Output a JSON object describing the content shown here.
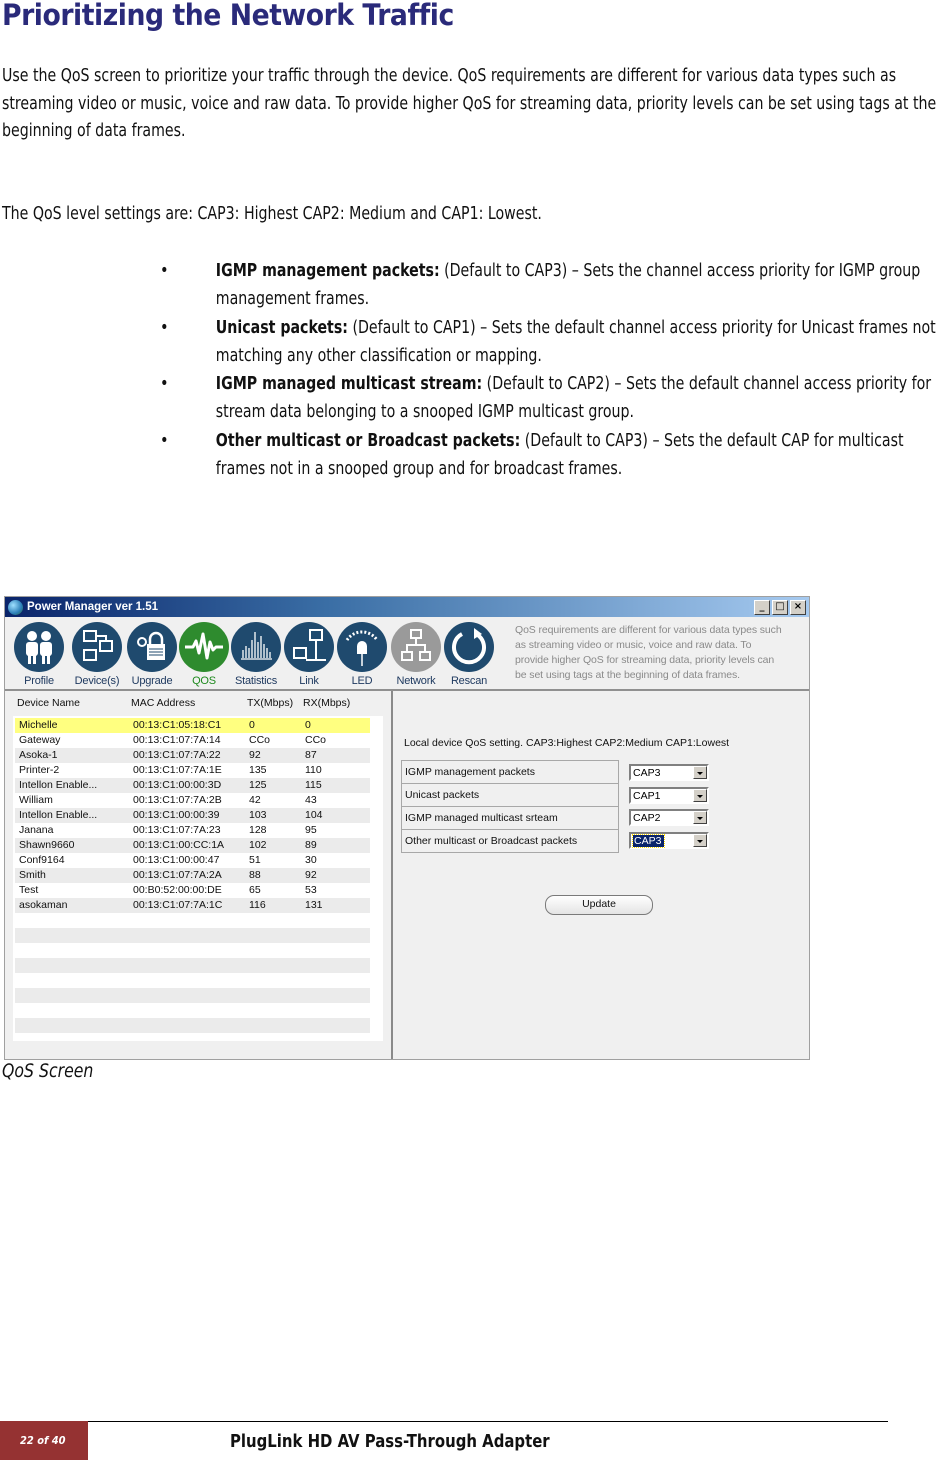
{
  "document": {
    "title": "Prioritizing the Network Traffic",
    "intro": "Use the QoS screen to prioritize your traffic through the device. QoS requirements are different for various data types such as streaming video or music, voice and raw data. To provide higher QoS for streaming data, priority levels can be set using tags at the beginning of data frames.",
    "levels": "The QoS level settings are: CAP3: Highest CAP2: Medium and CAP1: Lowest.",
    "bullets": [
      {
        "term": "IGMP management packets:",
        "text": " (Default to CAP3) – Sets the channel access priority for IGMP group management frames."
      },
      {
        "term": "Unicast packets:",
        "text": " (Default to CAP1) – Sets the default channel access priority for Unicast frames not matching any other classification or mapping."
      },
      {
        "term": "IGMP managed multicast stream:",
        "text": " (Default to CAP2) – Sets the default channel access priority for stream data belonging to a snooped IGMP multicast group."
      },
      {
        "term": "Other multicast or Broadcast packets:",
        "text": " (Default to CAP3) – Sets the default CAP for multicast frames not in a snooped group and for broadcast frames."
      }
    ],
    "bullet_glyph": "•",
    "figure_caption": "QoS Screen"
  },
  "window": {
    "title": "Power Manager ver 1.51",
    "controls": {
      "minimize": "_",
      "maximize": "□",
      "close": "×"
    },
    "toolbar": [
      {
        "label": "Profile",
        "icon": "people-icon"
      },
      {
        "label": "Device(s)",
        "icon": "devices-icon"
      },
      {
        "label": "Upgrade",
        "icon": "upgrade-lock-icon"
      },
      {
        "label": "QOS",
        "icon": "waveform-icon",
        "active": true
      },
      {
        "label": "Statistics",
        "icon": "bar-spectrum-icon"
      },
      {
        "label": "Link",
        "icon": "link-computers-icon"
      },
      {
        "label": "LED",
        "icon": "led-icon"
      },
      {
        "label": "Network",
        "icon": "network-tree-icon",
        "disabled": true
      },
      {
        "label": "Rescan",
        "icon": "rescan-icon"
      }
    ],
    "info_text": "QoS requirements are different for various data types such as streaming video or music, voice and raw data. To provide higher QoS for streaming data, priority levels can be set using tags at the beginning of data frames.",
    "device_table": {
      "headers": [
        "Device Name",
        "MAC Address",
        "TX(Mbps)",
        "RX(Mbps)"
      ],
      "rows": [
        [
          "Michelle",
          "00:13:C1:05:18:C1",
          "0",
          "0"
        ],
        [
          "Gateway",
          "00:13:C1:07:7A:14",
          "CCo",
          "CCo"
        ],
        [
          "Asoka-1",
          "00:13:C1:07:7A:22",
          "92",
          "87"
        ],
        [
          "Printer-2",
          "00:13:C1:07:7A:1E",
          "135",
          "110"
        ],
        [
          "Intellon Enable...",
          "00:13:C1:00:00:3D",
          "125",
          "115"
        ],
        [
          "William",
          "00:13:C1:07:7A:2B",
          "42",
          "43"
        ],
        [
          "Intellon Enable...",
          "00:13:C1:00:00:39",
          "103",
          "104"
        ],
        [
          "Janana",
          "00:13:C1:07:7A:23",
          "128",
          "95"
        ],
        [
          "Shawn9660",
          "00:13:C1:00:CC:1A",
          "102",
          "89"
        ],
        [
          "Conf9164",
          "00:13:C1:00:00:47",
          "51",
          "30"
        ],
        [
          "Smith",
          "00:13:C1:07:7A:2A",
          "88",
          "92"
        ],
        [
          "Test",
          "00:B0:52:00:00:DE",
          "65",
          "53"
        ],
        [
          "asokaman",
          "00:13:C1:07:7A:1C",
          "116",
          "131"
        ]
      ],
      "selected_row": 0
    },
    "qos": {
      "caption": "Local device QoS setting. CAP3:Highest CAP2:Medium CAP1:Lowest",
      "settings": [
        {
          "label": "IGMP management packets",
          "value": "CAP3"
        },
        {
          "label": "Unicast packets",
          "value": "CAP1"
        },
        {
          "label": "IGMP managed multicast srteam",
          "value": "CAP2"
        },
        {
          "label": "Other multicast or Broadcast packets",
          "value": "CAP3",
          "focused": true
        }
      ],
      "update_label": "Update"
    }
  },
  "footer": {
    "page": "22  of  40",
    "title": "PlugLink HD AV Pass-Through Adapter",
    "badge_color": "#953232"
  }
}
